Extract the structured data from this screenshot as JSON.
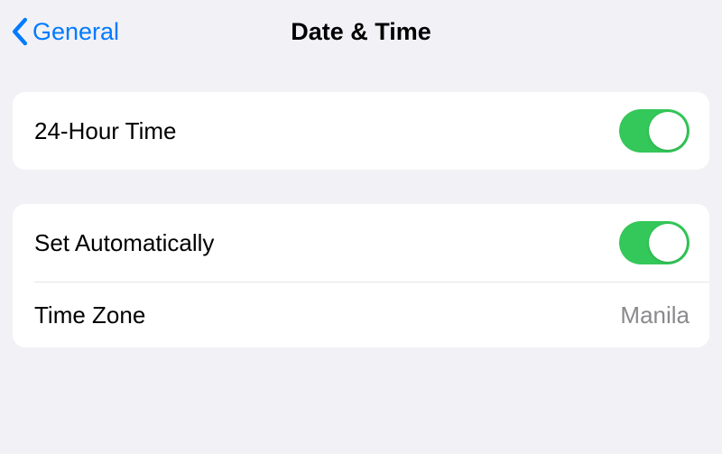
{
  "header": {
    "back_label": "General",
    "title": "Date & Time"
  },
  "groups": [
    {
      "rows": [
        {
          "label": "24-Hour Time",
          "type": "toggle",
          "on": true
        }
      ]
    },
    {
      "rows": [
        {
          "label": "Set Automatically",
          "type": "toggle",
          "on": true
        },
        {
          "label": "Time Zone",
          "type": "value",
          "value": "Manila"
        }
      ]
    }
  ],
  "colors": {
    "accent_blue": "#007aff",
    "toggle_green": "#34c759",
    "background": "#f2f1f6",
    "secondary_text": "#8a8a8e"
  }
}
